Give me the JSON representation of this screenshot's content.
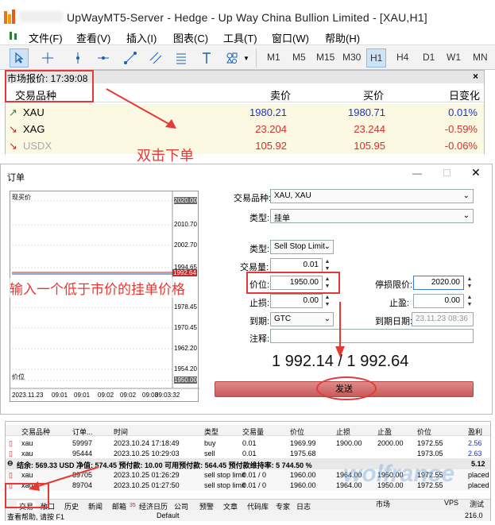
{
  "window": {
    "title": "UpWayMT5-Server - Hedge - Up Way China Bullion Limited - [XAU,H1]"
  },
  "menu": [
    "文件(F)",
    "查看(V)",
    "插入(I)",
    "图表(C)",
    "工具(T)",
    "窗口(W)",
    "帮助(H)"
  ],
  "timeframes": [
    "M1",
    "M5",
    "M15",
    "M30",
    "H1",
    "H4",
    "D1",
    "W1",
    "MN"
  ],
  "market_watch": {
    "title": "市场报价: 17:39:08",
    "headers": {
      "symbol": "交易品种",
      "bid": "卖价",
      "ask": "买价",
      "change": "日变化"
    },
    "rows": [
      {
        "symbol": "XAU",
        "bid": "1980.21",
        "ask": "1980.71",
        "change": "0.01%",
        "color": "#2f7d32",
        "valcolor": "#1a33cc"
      },
      {
        "symbol": "XAG",
        "bid": "23.204",
        "ask": "23.244",
        "change": "-0.59%",
        "color": "#c62828",
        "valcolor": "#d32f2f"
      },
      {
        "symbol": "USDX",
        "bid": "105.92",
        "ask": "105.95",
        "change": "-0.06%",
        "color": "#c62828",
        "valcolor": "#d32f2f"
      }
    ],
    "close": "×"
  },
  "annotations": {
    "double_click": "双击下单",
    "enter_price": "输入一个低于市价的挂单价格"
  },
  "order": {
    "title": "订单",
    "chart": {
      "symbol_label": "现买价",
      "bottom_label": "价位",
      "price_ticks": [
        "2020.00",
        "2010.70",
        "2002.70",
        "1994.65",
        "1978.45",
        "1970.45",
        "1962.20",
        "1954.20",
        "1950.00"
      ],
      "current_tag": "1992.64",
      "time_ticks": [
        "2023.11.23",
        "09:01",
        "09:01",
        "09:02",
        "09:02",
        "09:03",
        "09:03:32"
      ]
    },
    "symbol_label": "交易品种:",
    "symbol_value": "XAU, XAU",
    "type_label": "类型:",
    "type_value": "挂单",
    "subtype_label": "类型:",
    "subtype_value": "Sell Stop Limit",
    "volume_label": "交易量:",
    "volume_value": "0.01",
    "price_label": "价位:",
    "price_value": "1950.00",
    "stoplimit_label": "停损限价:",
    "stoplimit_value": "2020.00",
    "sl_label": "止损:",
    "sl_value": "0.00",
    "tp_label": "止盈:",
    "tp_value": "0.00",
    "expiry_label": "到期:",
    "expiry_value": "GTC",
    "expdate_label": "到期日期:",
    "expdate_value": "23.11.23 08:36",
    "comment_label": "注释:",
    "bid_ask": "1 992.14 / 1 992.64",
    "send_button": "发送"
  },
  "terminal": {
    "headers": [
      "交易品种",
      "订单...",
      "时间",
      "类型",
      "交易量",
      "价位",
      "止损",
      "止盈",
      "价位",
      "",
      "盈利"
    ],
    "rows": [
      [
        "xau",
        "59997",
        "2023.10.24 17:18:49",
        "buy",
        "0.01",
        "1969.99",
        "1900.00",
        "2000.00",
        "1972.55",
        "",
        "2.56"
      ],
      [
        "xau",
        "95444",
        "2023.10.25 10:29:03",
        "sell",
        "0.01",
        "1975.68",
        "",
        "",
        "1973.05",
        "",
        "2.63"
      ],
      [
        "xau",
        "89705",
        "2023.10.25 01:26:29",
        "sell stop limit",
        "0.01 / 0",
        "1960.00",
        "1964.00",
        "1950.00",
        "1972.55",
        "",
        "placed"
      ],
      [
        "xau",
        "89704",
        "2023.10.25 01:27:50",
        "sell stop limit",
        "0.01 / 0",
        "1960.00",
        "1964.00",
        "1950.00",
        "1972.55",
        "",
        "placed"
      ]
    ],
    "balance": "结余: 569.33 USD  净值: 574.45  预付款: 10.00  可用预付款: 564.45  预付款维持率: 5 744.50 %",
    "balance_profit": "5.12",
    "tabs": [
      "交易",
      "敞口",
      "历史",
      "新闻",
      "邮箱",
      "经济日历",
      "公司",
      "预警",
      "文章",
      "代码库",
      "专家",
      "日志"
    ],
    "mail_count": "35",
    "status_left": "查看帮助, 请按 F1",
    "status_mid": "Default",
    "status_right": "216.0",
    "market_tab": "市场",
    "vps": "VPS",
    "test": "测试",
    "watermark": "wolfrance"
  }
}
